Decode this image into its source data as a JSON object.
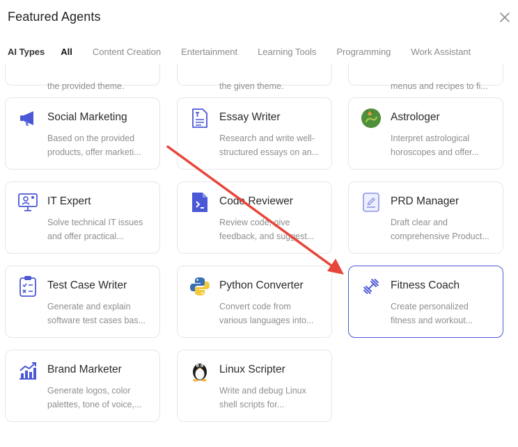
{
  "header": {
    "title": "Featured Agents"
  },
  "filters": {
    "label": "AI Types",
    "options": [
      "All",
      "Content Creation",
      "Entertainment",
      "Learning Tools",
      "Programming",
      "Work Assistant"
    ]
  },
  "partial_row": [
    {
      "desc2": "the provided theme."
    },
    {
      "desc2": "the given theme."
    },
    {
      "desc2": "menus and recipes to fi..."
    }
  ],
  "cards": [
    {
      "name": "Social Marketing",
      "desc1": "Based on the provided",
      "desc2": "products, offer marketi...",
      "icon": "megaphone-icon"
    },
    {
      "name": "Essay Writer",
      "desc1": "Research and write well-",
      "desc2": "structured essays on an...",
      "icon": "document-icon"
    },
    {
      "name": "Astrologer",
      "desc1": "Interpret astrological",
      "desc2": "horoscopes and offer...",
      "icon": "astrology-icon"
    },
    {
      "name": "IT Expert",
      "desc1": "Solve technical IT issues",
      "desc2": "and offer practical...",
      "icon": "computer-support-icon"
    },
    {
      "name": "Code Reviewer",
      "desc1": "Review code, give",
      "desc2": "feedback, and suggest...",
      "icon": "code-file-icon"
    },
    {
      "name": "PRD Manager",
      "desc1": "Draft clear and",
      "desc2": "comprehensive Product...",
      "icon": "prd-document-icon"
    },
    {
      "name": "Test Case Writer",
      "desc1": "Generate and explain",
      "desc2": "software test cases bas...",
      "icon": "clipboard-check-icon"
    },
    {
      "name": "Python Converter",
      "desc1": "Convert code from",
      "desc2": "various languages into...",
      "icon": "python-icon"
    },
    {
      "name": "Fitness Coach",
      "desc1": "Create personalized",
      "desc2": "fitness and workout...",
      "icon": "dumbbell-icon"
    },
    {
      "name": "Brand Marketer",
      "desc1": "Generate logos, color",
      "desc2": "palettes, tone of voice,...",
      "icon": "chart-growth-icon"
    },
    {
      "name": "Linux Scripter",
      "desc1": "Write and debug Linux",
      "desc2": "shell scripts for...",
      "icon": "tux-penguin-icon"
    }
  ],
  "colors": {
    "accent": "#4a57d6",
    "annotation_arrow": "#e8453a"
  }
}
